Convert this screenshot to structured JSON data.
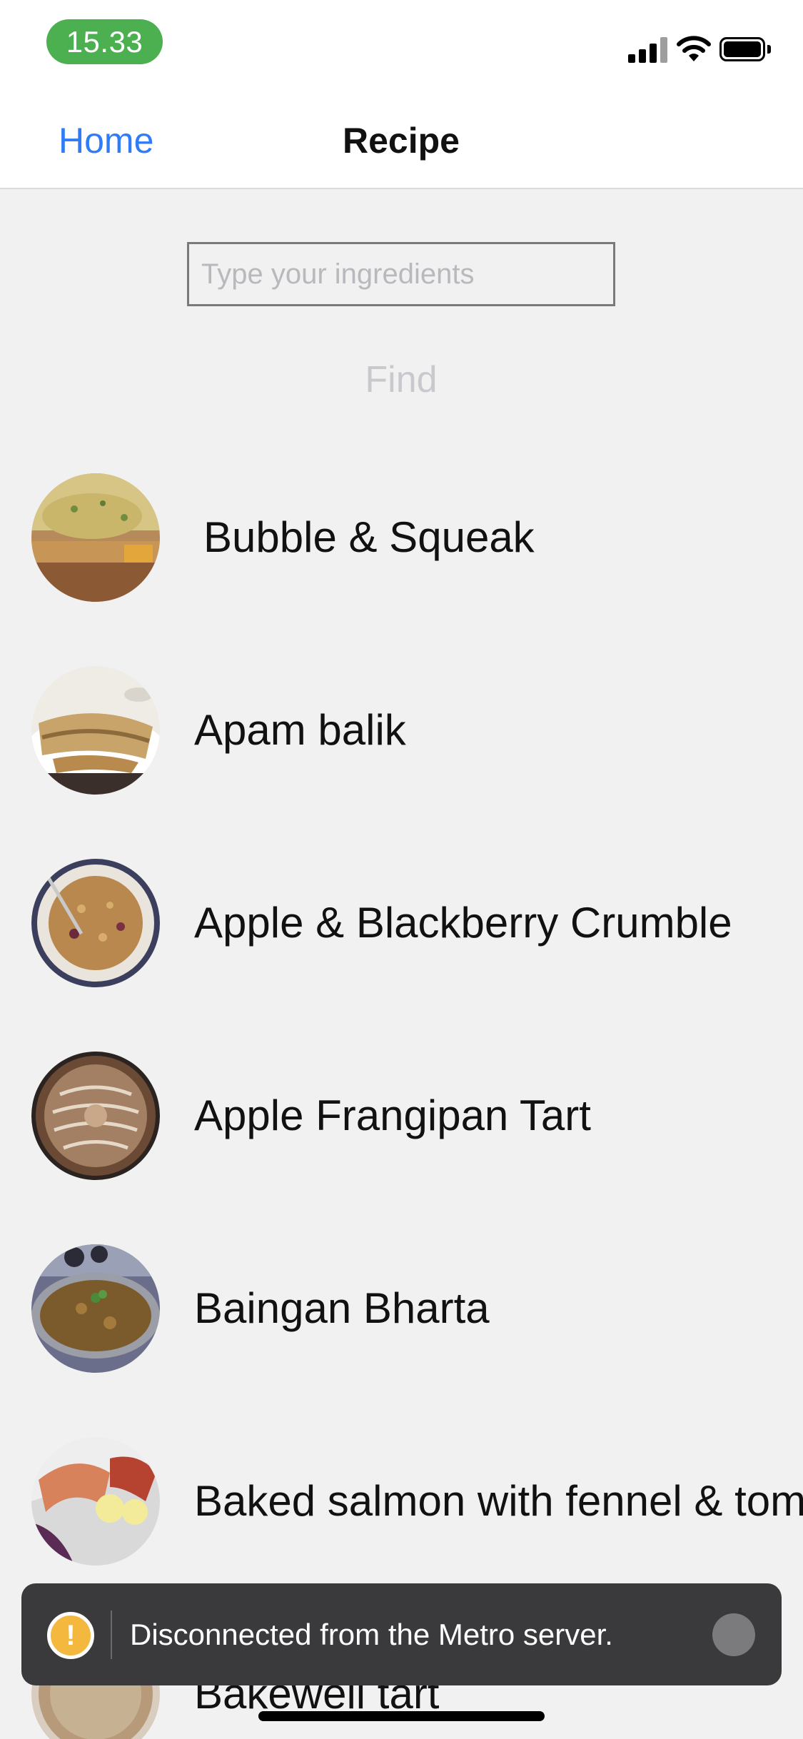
{
  "status_bar": {
    "time": "15.33",
    "signal_icon": "cellular-signal-icon",
    "wifi_icon": "wifi-icon",
    "battery_icon": "battery-icon",
    "time_pill_color": "#4caf50"
  },
  "header": {
    "back_label": "Home",
    "title": "Recipe",
    "accent_color": "#2f7cf6"
  },
  "search": {
    "placeholder": "Type your ingredients",
    "value": "",
    "find_label": "Find"
  },
  "recipes": [
    {
      "name": "Bubble & Squeak"
    },
    {
      "name": "Apam balik"
    },
    {
      "name": "Apple & Blackberry Crumble"
    },
    {
      "name": "Apple Frangipan Tart"
    },
    {
      "name": "Baingan Bharta"
    },
    {
      "name": "Baked salmon with fennel & tomatoes"
    },
    {
      "name": "Bakewell tart"
    }
  ],
  "toast": {
    "icon": "warning-icon",
    "message": "Disconnected from the Metro server.",
    "dismiss_icon": "dismiss-icon"
  }
}
